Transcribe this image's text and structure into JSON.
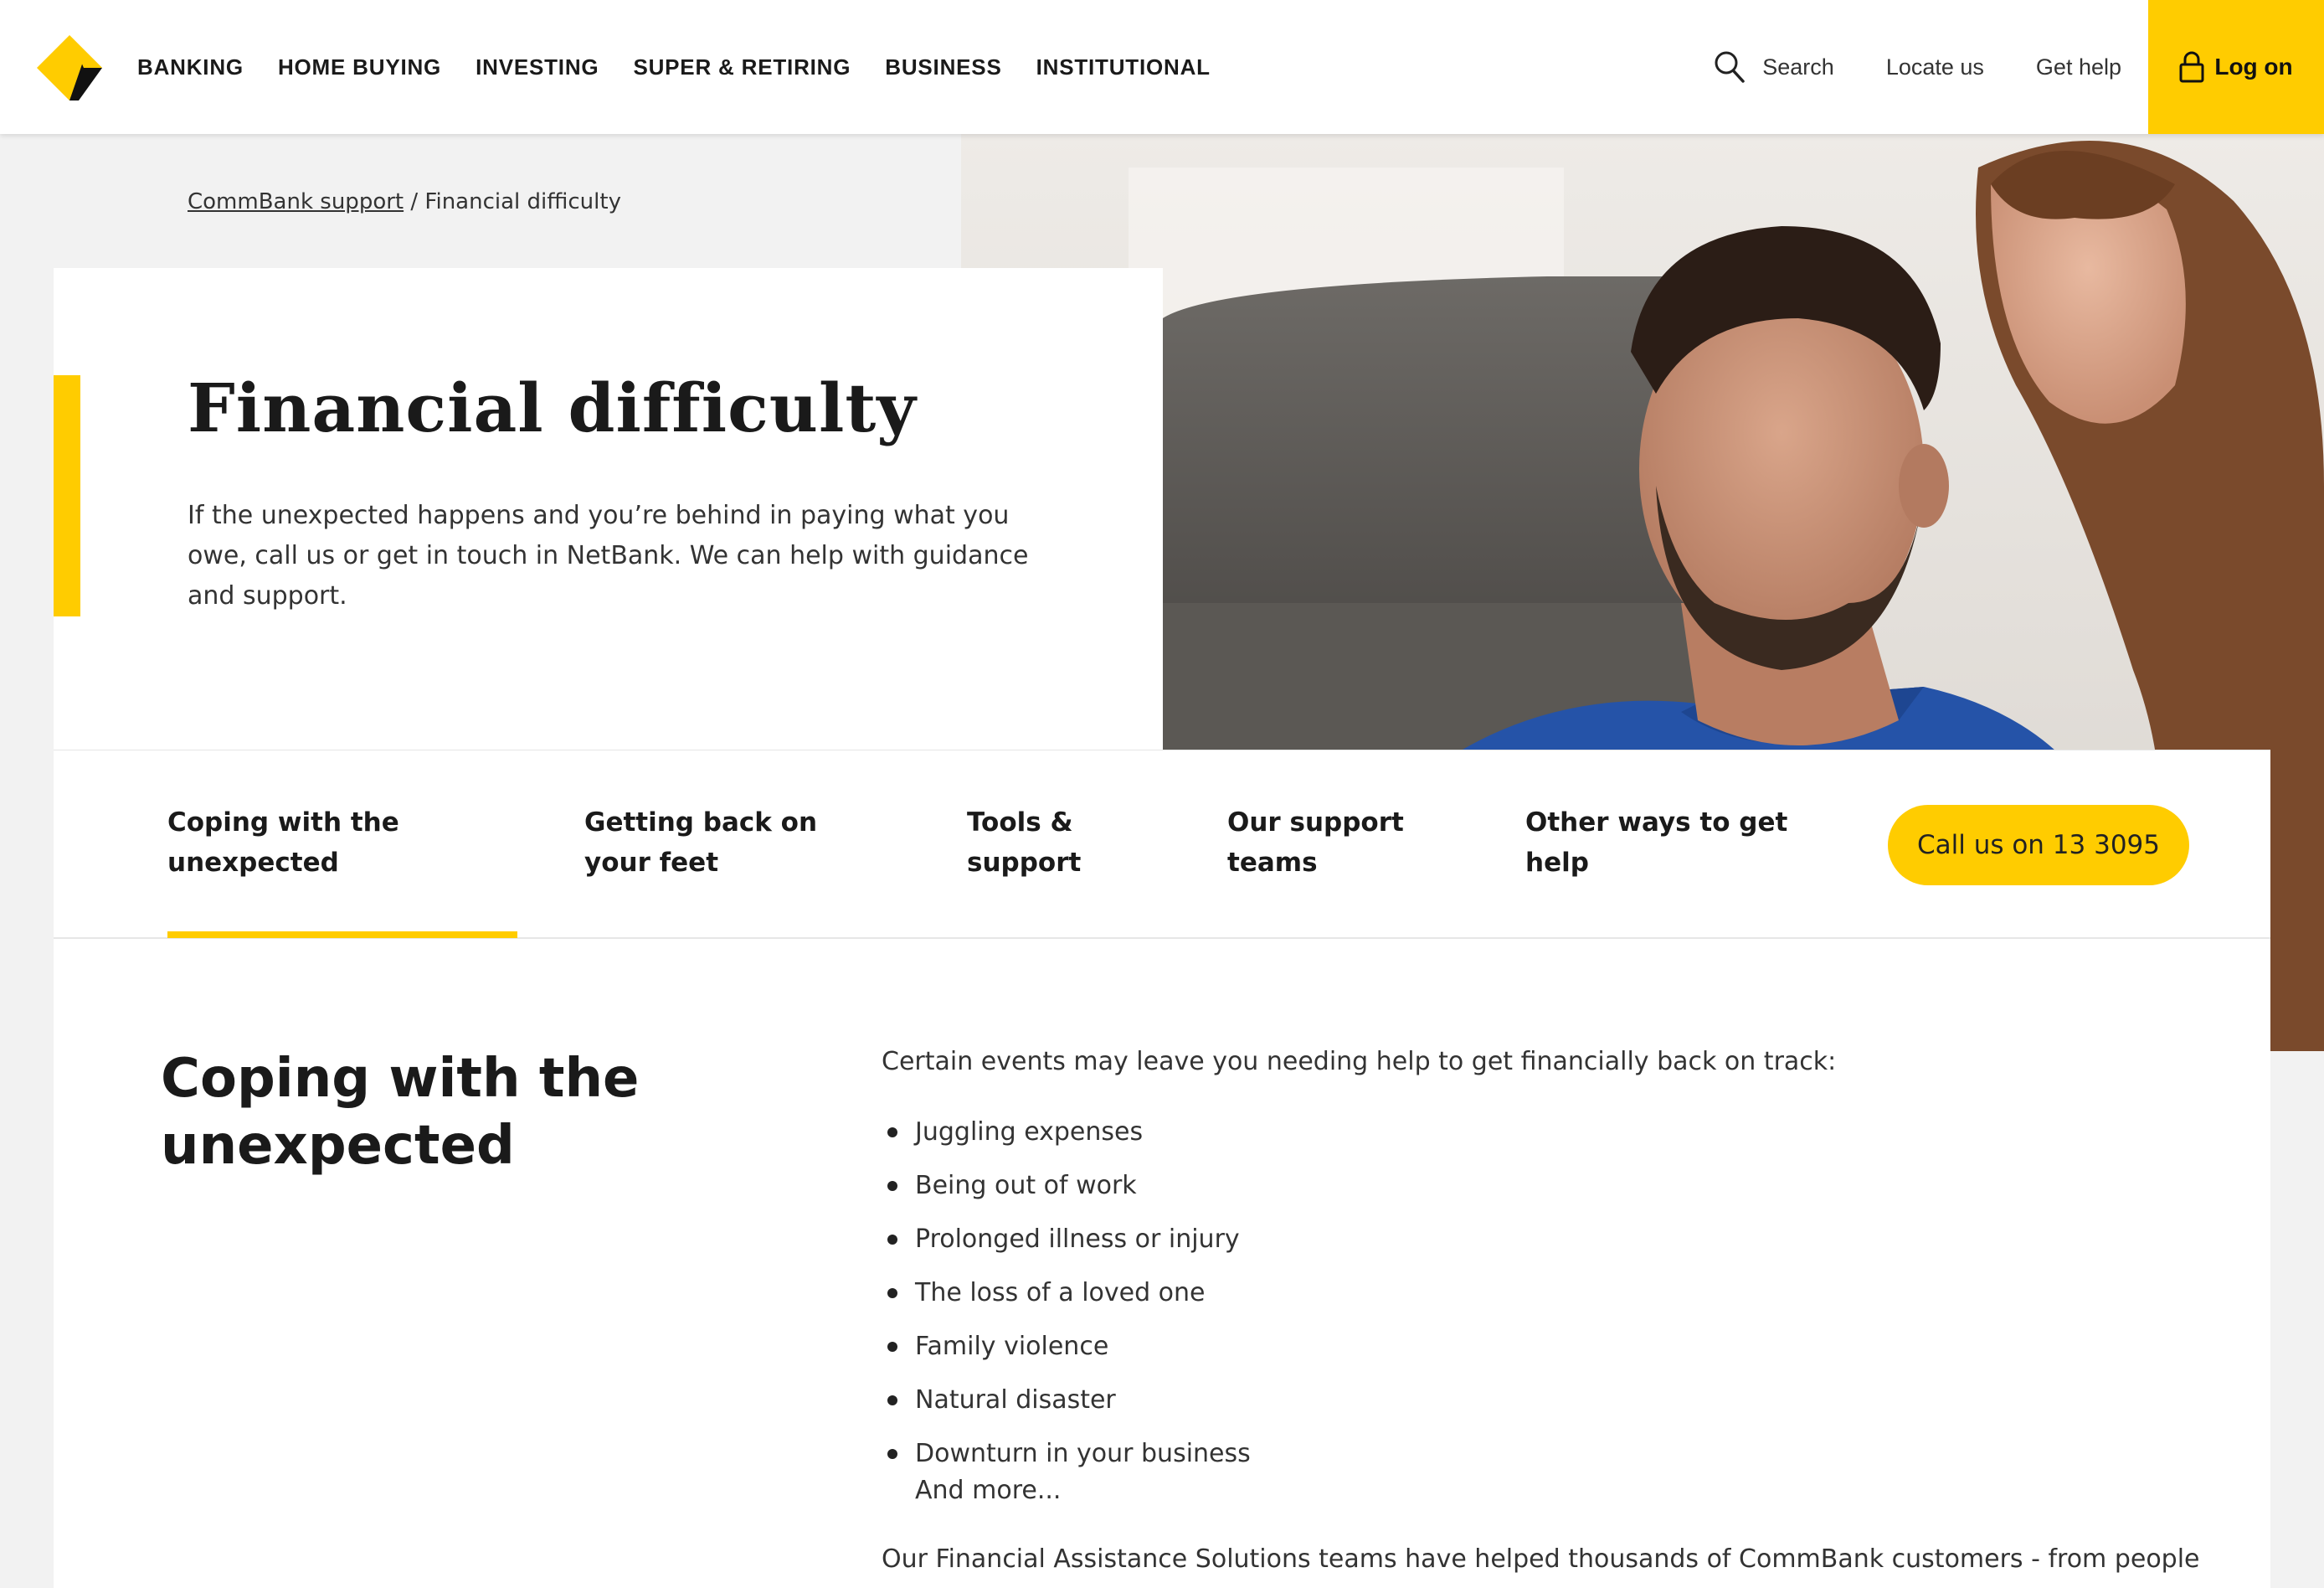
{
  "header": {
    "nav": [
      "BANKING",
      "HOME BUYING",
      "INVESTING",
      "SUPER & RETIRING",
      "BUSINESS",
      "INSTITUTIONAL"
    ],
    "search_label": "Search",
    "locate_label": "Locate us",
    "help_label": "Get help",
    "logon_label": "Log on"
  },
  "breadcrumb": {
    "parent": "CommBank support",
    "separator": " / ",
    "current": "Financial difficulty"
  },
  "hero": {
    "title": "Financial difficulty",
    "text": "If the unexpected happens and you’re behind in paying what you owe, call us or get in touch in NetBank. We can help with guidance and support."
  },
  "tabs": {
    "items": [
      "Coping with the unexpected",
      "Getting back on your feet",
      "Tools & support",
      "Our support teams",
      "Other ways to get help"
    ],
    "call_label": "Call us on 13 3095"
  },
  "content": {
    "title": "Coping with the unexpected",
    "intro": "Certain events may leave you needing help to get financially back on track:",
    "bullets": [
      "Juggling expenses",
      "Being out of work",
      "Prolonged illness or injury",
      "The loss of a loved one",
      "Family violence",
      "Natural disaster",
      "Downturn in your business"
    ],
    "more": "And more...",
    "paragraph": "Our Financial Assistance Solutions teams have helped thousands of CommBank customers - from people"
  },
  "colors": {
    "brand_yellow": "#ffcc00",
    "text_dark": "#1a1a1a",
    "page_bg": "#f2f2f2"
  },
  "icons": {
    "logo": "commbank-diamond-logo",
    "search": "search-icon",
    "lock": "lock-icon"
  }
}
